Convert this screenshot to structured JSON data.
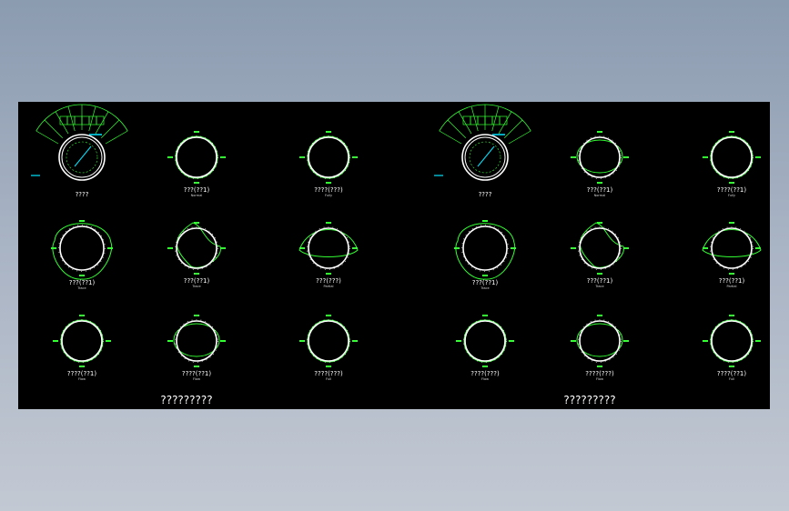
{
  "colors": {
    "background": "#000000",
    "circle": "#ffffff",
    "curve": "#33ff33",
    "dimension": "#00e5ff"
  },
  "sheets": [
    {
      "title": "?????????",
      "key_label": "????",
      "diagrams": [
        {
          "label": "???(??1)",
          "sub": "Normal",
          "shape": "ring"
        },
        {
          "label": "????(???)",
          "sub": "Fully",
          "shape": "ring"
        },
        {
          "label": "???(??1)",
          "sub": "Trace",
          "shape": "oval"
        },
        {
          "label": "???(??1)",
          "sub": "Trace",
          "shape": "blob"
        },
        {
          "label": "???(???)",
          "sub": "Partial",
          "shape": "lens"
        },
        {
          "label": "????(??1)",
          "sub": "Flow",
          "shape": "ring"
        },
        {
          "label": "????(??1)",
          "sub": "Flow",
          "shape": "ellipse"
        },
        {
          "label": "????(???)",
          "sub": "Full",
          "shape": "ring"
        }
      ]
    },
    {
      "title": "?????????",
      "key_label": "????",
      "diagrams": [
        {
          "label": "???(??1)",
          "sub": "Normal",
          "shape": "ellipse"
        },
        {
          "label": "????(??1)",
          "sub": "Fully",
          "shape": "ring"
        },
        {
          "label": "???(??1)",
          "sub": "Trace",
          "shape": "oval"
        },
        {
          "label": "???(??1)",
          "sub": "Trace",
          "shape": "blob"
        },
        {
          "label": "???(??1)",
          "sub": "Partial",
          "shape": "lens"
        },
        {
          "label": "????(???)",
          "sub": "Flow",
          "shape": "ring"
        },
        {
          "label": "????(???)",
          "sub": "Flow",
          "shape": "ellipse"
        },
        {
          "label": "????(??1)",
          "sub": "Full",
          "shape": "ring"
        }
      ]
    }
  ]
}
